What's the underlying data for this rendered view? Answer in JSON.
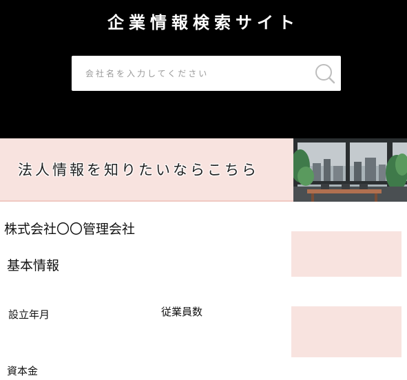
{
  "header": {
    "title": "企業情報検索サイト"
  },
  "search": {
    "placeholder": "会社名を入力してください",
    "icon": "search-icon"
  },
  "banner": {
    "text": "法人情報を知りたいならこちら",
    "image": "office-window-illustration"
  },
  "company": {
    "name": "株式会社〇〇管理会社",
    "section_title": "基本情報",
    "fields": {
      "founded_label": "設立年月",
      "employees_label": "従業員数",
      "capital_label": "資本金"
    }
  },
  "colors": {
    "header_bg": "#000000",
    "banner_bg": "#f8e3df",
    "accent_box": "#f8e3df"
  }
}
